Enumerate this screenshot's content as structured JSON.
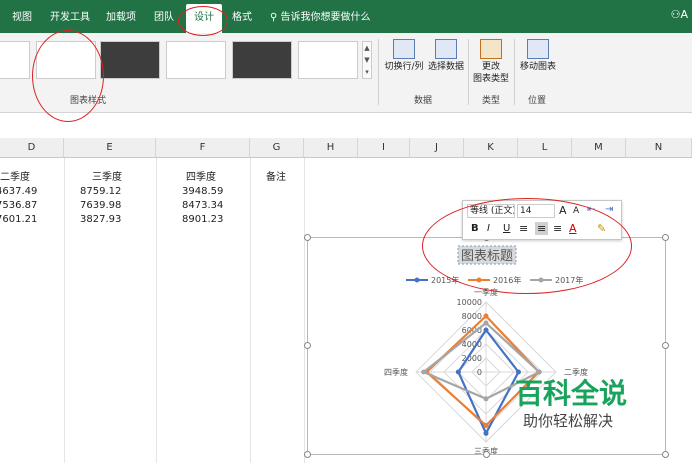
{
  "tabs": [
    "视图",
    "开发工具",
    "加载项",
    "团队",
    "设计",
    "格式"
  ],
  "active_tab": "设计",
  "search_hint": "告诉我你想要做什么",
  "user_glyph": "A",
  "ribbon": {
    "chart_styles_label": "图表样式",
    "data_group": {
      "label": "数据",
      "switch": "切换行/列",
      "select": "选择数据"
    },
    "type_group": {
      "label": "类型",
      "change": "更改\n图表类型"
    },
    "location_group": {
      "label": "位置",
      "move": "移动图表"
    }
  },
  "columns": [
    "D",
    "E",
    "F",
    "G",
    "H",
    "I",
    "J",
    "K",
    "L",
    "M",
    "N"
  ],
  "sheet": {
    "headers": {
      "D": "二季度",
      "E": "三季度",
      "F": "四季度",
      "G": "备注"
    },
    "rows": [
      [
        "4637.49",
        "8759.12",
        "3948.59"
      ],
      [
        "7536.87",
        "7639.98",
        "8473.34"
      ],
      [
        "7601.21",
        "3827.93",
        "8901.23"
      ]
    ]
  },
  "minitoolbar": {
    "font": "等线 (正文)",
    "size": "14",
    "bold": "B",
    "italic": "I",
    "underline": "U"
  },
  "chart_data": {
    "type": "radar",
    "title": "图表标题",
    "axes": [
      "一季度",
      "二季度",
      "三季度",
      "四季度"
    ],
    "rlim": [
      0,
      10000
    ],
    "ticks": [
      "10000",
      "8000",
      "6000",
      "4000",
      "2000",
      "0"
    ],
    "legend_position": "top",
    "series": [
      {
        "name": "2015年",
        "color": "#4472c4",
        "values": [
          6000,
          4637.49,
          8759.12,
          3948.59
        ]
      },
      {
        "name": "2016年",
        "color": "#ed7d31",
        "values": [
          8000,
          7536.87,
          7639.98,
          8473.34
        ]
      },
      {
        "name": "2017年",
        "color": "#a5a5a5",
        "values": [
          7000,
          7601.21,
          3827.93,
          8901.23
        ]
      }
    ]
  },
  "watermark": {
    "title": "百科全说",
    "subtitle": "助你轻松解决"
  }
}
